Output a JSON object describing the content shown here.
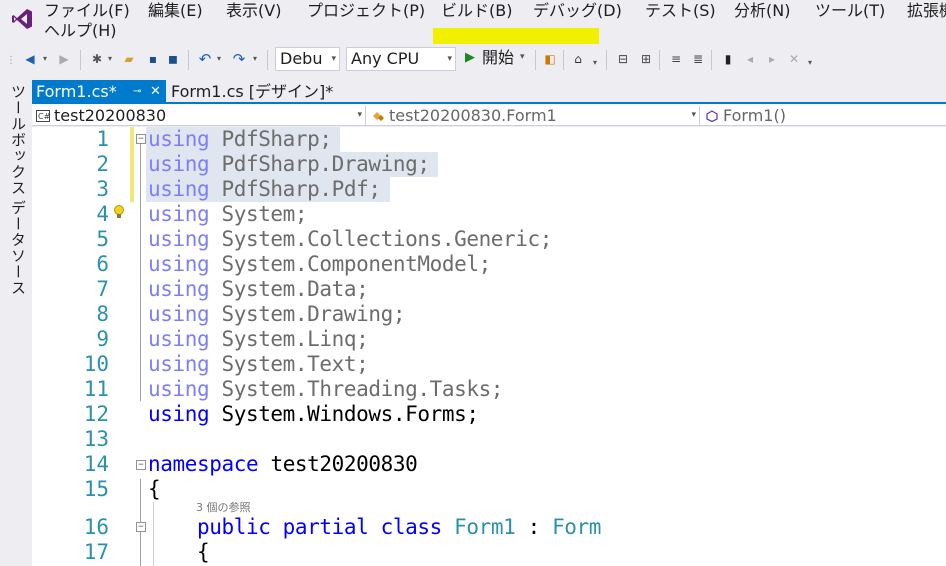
{
  "menubar": {
    "items": [
      {
        "label": "ファイル(F)"
      },
      {
        "label": "編集(E)"
      },
      {
        "label": "表示(V)"
      },
      {
        "label": "プロジェクト(P)"
      },
      {
        "label": "ビルド(B)"
      },
      {
        "label": "デバッグ(D)"
      },
      {
        "label": "テスト(S)"
      },
      {
        "label": "分析(N)"
      },
      {
        "label": "ツール(T)"
      },
      {
        "label": "拡張機"
      },
      {
        "label": "ヘルプ(H)"
      }
    ]
  },
  "toolbar": {
    "configuration": "Debu",
    "platform": "Any CPU",
    "start_label": "開始",
    "start_icon": "play-icon",
    "highlight_color": "#f1f000"
  },
  "side_panels": {
    "toolbox": "ツールボックス",
    "datasources": "データソース"
  },
  "tabs": {
    "active": "Form1.cs*",
    "design": "Form1.cs [デザイン]*"
  },
  "navbar": {
    "project": "test20200830",
    "class": "test20200830.Form1",
    "member": "Form1()"
  },
  "editor": {
    "codelens_refs": "3 個の参照",
    "lines": [
      {
        "n": "1",
        "parts": [
          {
            "t": "using",
            "c": "kw-dim"
          },
          {
            "t": " PdfSharp;",
            "c": "id-dim"
          }
        ]
      },
      {
        "n": "2",
        "parts": [
          {
            "t": "using",
            "c": "kw-dim"
          },
          {
            "t": " PdfSharp.Drawing;",
            "c": "id-dim"
          }
        ]
      },
      {
        "n": "3",
        "parts": [
          {
            "t": "using",
            "c": "kw-dim"
          },
          {
            "t": " PdfSharp.Pdf;",
            "c": "id-dim"
          }
        ]
      },
      {
        "n": "4",
        "parts": [
          {
            "t": "using",
            "c": "kw-dim"
          },
          {
            "t": " System;",
            "c": "id-dim"
          }
        ]
      },
      {
        "n": "5",
        "parts": [
          {
            "t": "using",
            "c": "kw-dim"
          },
          {
            "t": " System.Collections.Generic;",
            "c": "id-dim"
          }
        ]
      },
      {
        "n": "6",
        "parts": [
          {
            "t": "using",
            "c": "kw-dim"
          },
          {
            "t": " System.ComponentModel;",
            "c": "id-dim"
          }
        ]
      },
      {
        "n": "7",
        "parts": [
          {
            "t": "using",
            "c": "kw-dim"
          },
          {
            "t": " System.Data;",
            "c": "id-dim"
          }
        ]
      },
      {
        "n": "8",
        "parts": [
          {
            "t": "using",
            "c": "kw-dim"
          },
          {
            "t": " System.Drawing;",
            "c": "id-dim"
          }
        ]
      },
      {
        "n": "9",
        "parts": [
          {
            "t": "using",
            "c": "kw-dim"
          },
          {
            "t": " System.Linq;",
            "c": "id-dim"
          }
        ]
      },
      {
        "n": "10",
        "parts": [
          {
            "t": "using",
            "c": "kw-dim"
          },
          {
            "t": " System.Text;",
            "c": "id-dim"
          }
        ]
      },
      {
        "n": "11",
        "parts": [
          {
            "t": "using",
            "c": "kw-dim"
          },
          {
            "t": " System.Threading.Tasks;",
            "c": "id-dim"
          }
        ]
      },
      {
        "n": "12",
        "parts": [
          {
            "t": "using",
            "c": "kw"
          },
          {
            "t": " System.Windows.Forms;",
            "c": "id"
          }
        ]
      },
      {
        "n": "13",
        "parts": []
      },
      {
        "n": "14",
        "parts": [
          {
            "t": "namespace",
            "c": "kw"
          },
          {
            "t": " test20200830",
            "c": "id"
          }
        ]
      },
      {
        "n": "15",
        "parts": [
          {
            "t": "{",
            "c": "id"
          }
        ]
      },
      {
        "n": "16",
        "parts": [
          {
            "t": "    public",
            "c": "kw"
          },
          {
            "t": " partial",
            "c": "kw"
          },
          {
            "t": " class",
            "c": "kw"
          },
          {
            "t": " Form1",
            "c": "type"
          },
          {
            "t": " : ",
            "c": "id"
          },
          {
            "t": "Form",
            "c": "type"
          }
        ]
      },
      {
        "n": "17",
        "parts": [
          {
            "t": "    {",
            "c": "id"
          }
        ]
      }
    ]
  }
}
